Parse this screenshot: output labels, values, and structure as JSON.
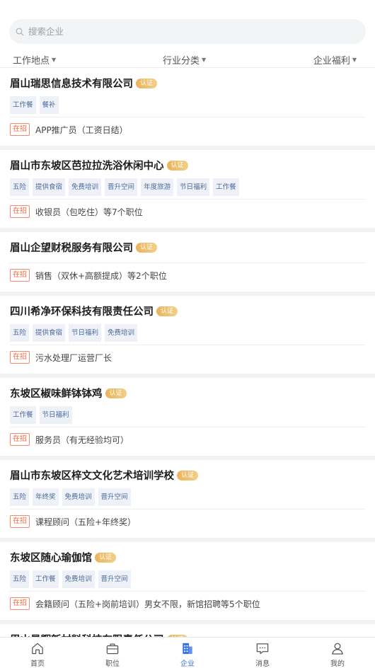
{
  "search": {
    "placeholder": "搜索企业"
  },
  "filters": [
    "工作地点",
    "行业分类",
    "企业福利"
  ],
  "hiring_label": "在招",
  "verified_label": "认证",
  "companies": [
    {
      "name": "眉山瑞思信息技术有限公司",
      "tags": [
        "工作餐",
        "餐补"
      ],
      "job": "APP推广员（工资日结）"
    },
    {
      "name": "眉山市东坡区芭拉拉洗浴休闲中心",
      "tags": [
        "五险",
        "提供食宿",
        "免费培训",
        "晋升空间",
        "年度旅游",
        "节日福利",
        "工作餐"
      ],
      "job": "收银员（包吃住）等7个职位"
    },
    {
      "name": "眉山企望财税服务有限公司",
      "tags": [],
      "job": "销售（双休+高额提成）等2个职位"
    },
    {
      "name": "四川希净环保科技有限责任公司",
      "tags": [
        "五险",
        "提供食宿",
        "节日福利",
        "免费培训"
      ],
      "job": "污水处理厂运营厂长"
    },
    {
      "name": "东坡区椒味鲜钵钵鸡",
      "tags": [
        "工作餐",
        "节日福利"
      ],
      "job": "服务员（有无经验均可）"
    },
    {
      "name": "眉山市东坡区梓文文化艺术培训学校",
      "tags": [
        "五险",
        "年终奖",
        "免费培训",
        "晋升空间"
      ],
      "job": "课程顾问（五险+年终奖）"
    },
    {
      "name": "东坡区随心瑜伽馆",
      "tags": [
        "五险",
        "工作餐",
        "免费培训",
        "晋升空间"
      ],
      "job": "会籍顾问（五险+岗前培训）男女不限，新馆招聘等5个职位"
    },
    {
      "name": "眉山昊辉新材料科技有限责任公司",
      "tags": [],
      "job": ""
    }
  ],
  "tabbar": [
    {
      "label": "首页",
      "icon": "home-icon",
      "active": false
    },
    {
      "label": "职位",
      "icon": "briefcase-icon",
      "active": false
    },
    {
      "label": "企业",
      "icon": "building-icon",
      "active": true
    },
    {
      "label": "消息",
      "icon": "message-icon",
      "active": false
    },
    {
      "label": "我的",
      "icon": "user-icon",
      "active": false
    }
  ],
  "colors": {
    "accent": "#2f6fe0",
    "hiring": "#ea6a45",
    "verified": "#e9b45b",
    "tag_bg": "#eef2f8",
    "tag_text": "#4b6a9b"
  }
}
